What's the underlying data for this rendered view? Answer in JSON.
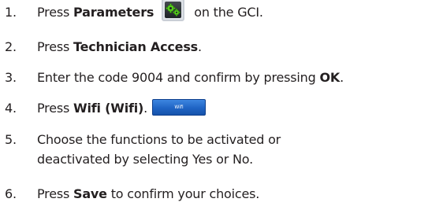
{
  "steps": [
    {
      "number": "1.",
      "before": "Press ",
      "bold": "Parameters",
      "after": "on the GCI.",
      "icon": "gear-settings-icon",
      "icon_color": "#5ad21f"
    },
    {
      "number": "2.",
      "before": "Press ",
      "bold": "Technician Access",
      "after": "."
    },
    {
      "number": "3.",
      "before": "Enter the code 9004 and confirm by pressing ",
      "bold": "OK",
      "after": "."
    },
    {
      "number": "4.",
      "before": "Press ",
      "bold": "Wifi (Wifi)",
      "after": ".",
      "button_label": "Wifi",
      "button_color": "#2a72d4"
    },
    {
      "number": "5.",
      "line1": "Choose the functions to be activated or",
      "line2": "deactivated by selecting Yes or No."
    },
    {
      "number": "6.",
      "before": "Press ",
      "bold": "Save",
      "after": " to confirm your choices."
    }
  ]
}
